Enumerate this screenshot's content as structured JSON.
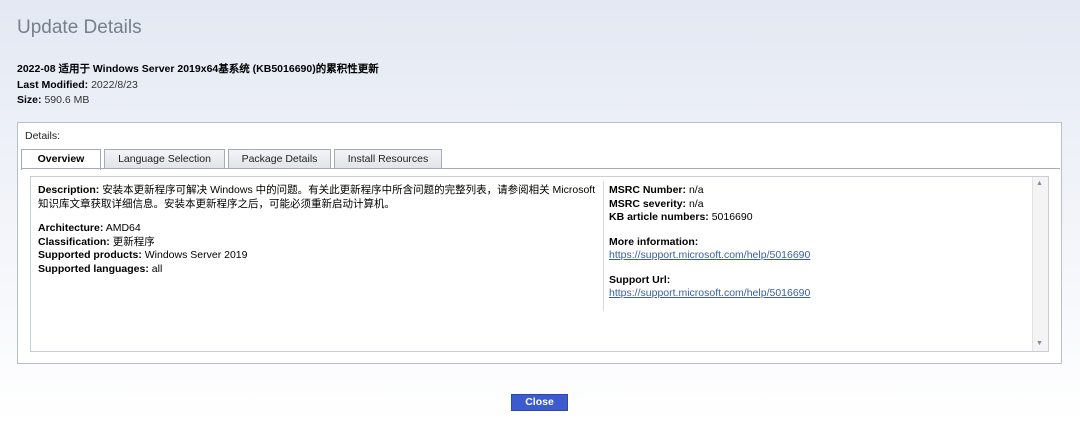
{
  "page": {
    "title": "Update Details"
  },
  "summary": {
    "update_title": "2022-08 适用于 Windows Server 2019x64基系统 (KB5016690)的累积性更新",
    "last_modified_label": "Last Modified:",
    "last_modified_value": "2022/8/23",
    "size_label": "Size:",
    "size_value": "590.6 MB"
  },
  "details": {
    "label": "Details:",
    "tabs": [
      {
        "label": "Overview",
        "active": true
      },
      {
        "label": "Language Selection",
        "active": false
      },
      {
        "label": "Package Details",
        "active": false
      },
      {
        "label": "Install Resources",
        "active": false
      }
    ],
    "overview": {
      "description_label": "Description:",
      "description_value": "安装本更新程序可解决 Windows 中的问题。有关此更新程序中所含问题的完整列表，请参阅相关 Microsoft 知识库文章获取详细信息。安装本更新程序之后，可能必须重新启动计算机。",
      "architecture_label": "Architecture:",
      "architecture_value": "AMD64",
      "classification_label": "Classification:",
      "classification_value": "更新程序",
      "products_label": "Supported products:",
      "products_value": "Windows Server 2019",
      "languages_label": "Supported languages:",
      "languages_value": "all",
      "msrc_number_label": "MSRC Number:",
      "msrc_number_value": "n/a",
      "msrc_severity_label": "MSRC severity:",
      "msrc_severity_value": "n/a",
      "kb_label": "KB article numbers:",
      "kb_value": "5016690",
      "more_info_label": "More information:",
      "more_info_url": "https://support.microsoft.com/help/5016690",
      "support_url_label": "Support Url:",
      "support_url": "https://support.microsoft.com/help/5016690"
    }
  },
  "footer": {
    "close_label": "Close"
  },
  "colors": {
    "accent": "#3b5bcf",
    "link": "#3b5da8",
    "title": "#777e8c"
  }
}
